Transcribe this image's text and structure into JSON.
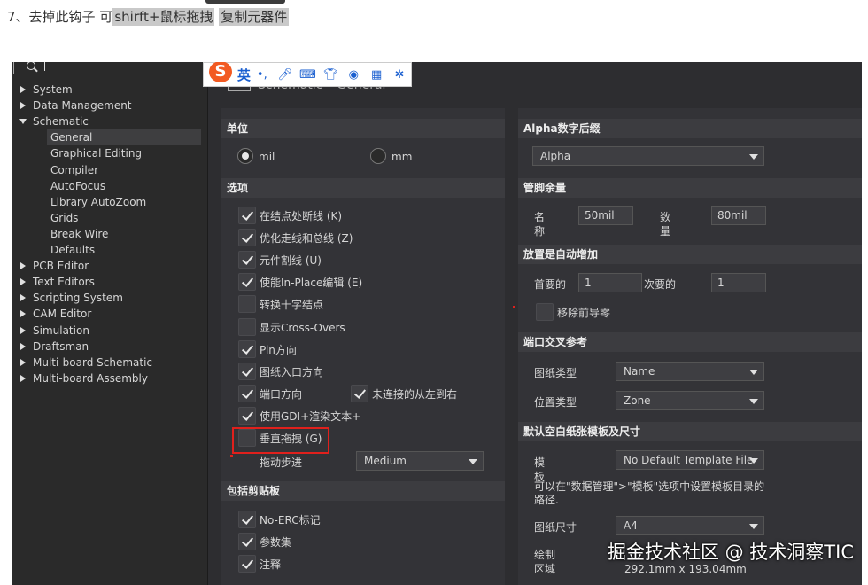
{
  "blog": {
    "step": "7、去掉此钩子 可",
    "highlight1": "shirft+鼠标拖拽",
    "space": " ",
    "highlight2": "复制元器件"
  },
  "ime": {
    "lang": "英",
    "icons": [
      "punctuation-icon",
      "mic-icon",
      "keyboard-icon",
      "skin-icon",
      "toolbox-icon",
      "apps-icon",
      "settings-icon"
    ]
  },
  "page_title": "Schematic – General",
  "tree": [
    {
      "label": "System",
      "level": 0,
      "expanded": false
    },
    {
      "label": "Data Management",
      "level": 0,
      "expanded": false
    },
    {
      "label": "Schematic",
      "level": 0,
      "expanded": true
    },
    {
      "label": "General",
      "level": 1,
      "selected": true
    },
    {
      "label": "Graphical Editing",
      "level": 1
    },
    {
      "label": "Compiler",
      "level": 1
    },
    {
      "label": "AutoFocus",
      "level": 1
    },
    {
      "label": "Library AutoZoom",
      "level": 1
    },
    {
      "label": "Grids",
      "level": 1
    },
    {
      "label": "Break Wire",
      "level": 1
    },
    {
      "label": "Defaults",
      "level": 1
    },
    {
      "label": "PCB Editor",
      "level": 0,
      "expanded": false
    },
    {
      "label": "Text Editors",
      "level": 0,
      "expanded": false
    },
    {
      "label": "Scripting System",
      "level": 0,
      "expanded": false
    },
    {
      "label": "CAM Editor",
      "level": 0,
      "expanded": false
    },
    {
      "label": "Simulation",
      "level": 0,
      "expanded": false
    },
    {
      "label": "Draftsman",
      "level": 0,
      "expanded": false
    },
    {
      "label": "Multi-board Schematic",
      "level": 0,
      "expanded": false
    },
    {
      "label": "Multi-board Assembly",
      "level": 0,
      "expanded": false
    }
  ],
  "units": {
    "title": "单位",
    "mil": "mil",
    "mm": "mm",
    "selected": "mil"
  },
  "options": {
    "title": "选项",
    "items": [
      {
        "label": "在结点处断线 (K)",
        "checked": true
      },
      {
        "label": "优化走线和总线 (Z)",
        "checked": true
      },
      {
        "label": "元件割线 (U)",
        "checked": true
      },
      {
        "label": "使能In-Place编辑 (E)",
        "checked": true
      },
      {
        "label": "转换十字结点",
        "checked": false
      },
      {
        "label": "显示Cross-Overs",
        "checked": false
      },
      {
        "label": "Pin方向",
        "checked": true
      },
      {
        "label": "图纸入口方向",
        "checked": true
      },
      {
        "label": "端口方向",
        "checked": true
      },
      {
        "label": "使用GDI+渲染文本+",
        "checked": true
      },
      {
        "label": "垂直拖拽 (G)",
        "checked": false
      }
    ],
    "unconnected_label": "未连接的从左到右",
    "unconnected_checked": true,
    "drag_step_label": "拖动步进",
    "drag_step_value": "Medium"
  },
  "clipboard": {
    "title": "包括剪贴板",
    "items": [
      {
        "label": "No-ERC标记",
        "checked": true
      },
      {
        "label": "参数集",
        "checked": true
      },
      {
        "label": "注释",
        "checked": true
      }
    ]
  },
  "alpha": {
    "title": "Alpha数字后缀",
    "value": "Alpha"
  },
  "pin_margin": {
    "title": "管脚余量",
    "name_label": "名称",
    "name_value": "50mil",
    "qty_label": "数量",
    "qty_value": "80mil"
  },
  "auto_inc": {
    "title": "放置是自动增加",
    "primary_label": "首要的",
    "primary_value": "1",
    "secondary_label": "次要的",
    "secondary_value": "1",
    "remove_zero_label": "移除前导零"
  },
  "port_ref": {
    "title": "端口交叉参考",
    "sheet_type_label": "图纸类型",
    "sheet_type_value": "Name",
    "pos_type_label": "位置类型",
    "pos_type_value": "Zone"
  },
  "template": {
    "title": "默认空白纸张模板及尺寸",
    "template_label": "模板",
    "template_value": "No Default Template File",
    "hint": "可以在\"数据管理\">\"模板\"选项中设置模板目录的路径.",
    "size_label": "图纸尺寸",
    "size_value": "A4",
    "draw_area_label": "绘制区域",
    "draw_area_value": "292.1mm x 193.04mm"
  },
  "watermark": "掘金技术社区 @ 技术洞察TIC"
}
